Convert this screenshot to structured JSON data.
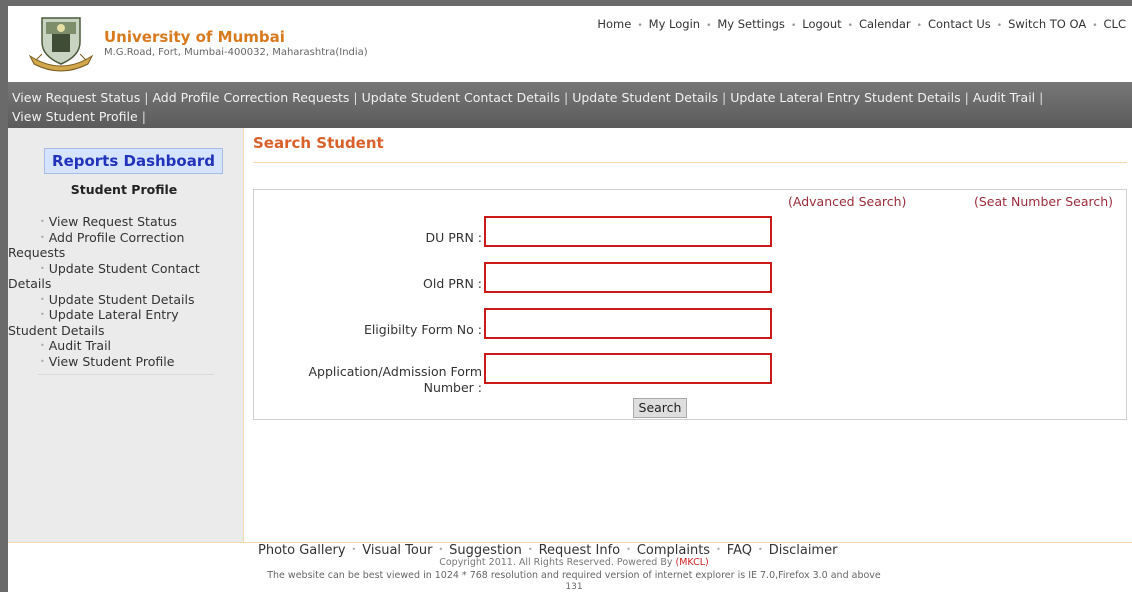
{
  "header": {
    "university_name": "University of Mumbai",
    "address": "M.G.Road, Fort, Mumbai-400032, Maharashtra(India)",
    "top_links": [
      "Home",
      "My Login",
      "My Settings",
      "Logout",
      "Calendar",
      "Contact Us",
      "Switch TO OA",
      "CLC"
    ]
  },
  "navbar": {
    "row1": [
      "View Request Status",
      "Add Profile Correction Requests",
      "Update Student Contact Details",
      "Update Student Details",
      "Update Lateral Entry Student Details",
      "Audit Trail"
    ],
    "row2": [
      "View Student Profile"
    ]
  },
  "sidebar": {
    "dashboard_button": "Reports Dashboard",
    "section_title": "Student Profile",
    "items": [
      {
        "line1": "View Request Status",
        "line2": ""
      },
      {
        "line1": "Add Profile Correction",
        "line2": "Requests"
      },
      {
        "line1": "Update Student Contact",
        "line2": "Details"
      },
      {
        "line1": "Update Student Details",
        "line2": ""
      },
      {
        "line1": "Update Lateral Entry",
        "line2": "Student Details"
      },
      {
        "line1": "Audit Trail",
        "line2": ""
      },
      {
        "line1": "View Student Profile",
        "line2": ""
      }
    ]
  },
  "main": {
    "title": "Search Student",
    "advanced_search": "(Advanced Search)",
    "seat_number_search": "(Seat Number Search)",
    "fields": [
      {
        "label": "DU PRN :",
        "value": ""
      },
      {
        "label": "Old PRN :",
        "value": ""
      },
      {
        "label": "Eligibilty Form No :",
        "value": ""
      },
      {
        "label_line1": "Application/Admission Form",
        "label_line2": "Number :",
        "value": ""
      }
    ],
    "search_button": "Search"
  },
  "footer": {
    "links": [
      "Photo Gallery",
      "Visual Tour",
      "Suggestion",
      "Request Info",
      "Complaints",
      "FAQ",
      "Disclaimer"
    ],
    "copyright_prefix": "Copyright 2011. All Rights Reserved. Powered By",
    "copyright_brand": "(MKCL)",
    "resolution_note": "The website can be best viewed in 1024 * 768 resolution and required version of internet explorer is IE 7.0,Firefox 3.0 and above",
    "counter": "131"
  },
  "colors": {
    "brand_orange": "#d87a1e",
    "title_orange": "#d8602a",
    "input_border_red": "#cc1a1a",
    "link_maroon": "#9b2c3b",
    "navbar_gray": "#666666",
    "dashboard_blue": "#2233bb"
  }
}
